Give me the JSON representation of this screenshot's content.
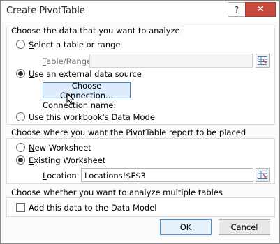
{
  "window": {
    "title": "Create PivotTable",
    "help_glyph": "?",
    "close_glyph": "✕"
  },
  "section_data": {
    "legend": "Choose the data that you want to analyze",
    "option_table_label": "Select a table or range",
    "table_range_label": "Table/Range:",
    "table_range_value": "",
    "option_external_label": "Use an external data source",
    "choose_connection_label": "Choose Connection...",
    "connection_name_label": "Connection name:",
    "option_datamodel_label": "Use this workbook's Data Model",
    "selected": "external"
  },
  "section_placement": {
    "legend": "Choose where you want the PivotTable report to be placed",
    "option_new_label": "New Worksheet",
    "option_existing_label": "Existing Worksheet",
    "location_label": "Location:",
    "location_value": "Locations!$F$3",
    "selected": "existing"
  },
  "section_multi": {
    "legend": "Choose whether you want to analyze multiple tables",
    "add_datamodel_label": "Add this data to the Data Model",
    "add_datamodel_checked": false
  },
  "footer": {
    "ok_label": "OK",
    "cancel_label": "Cancel"
  },
  "icons": {
    "range_selector": "range-selector-icon",
    "cursor": "mouse-pointer-icon"
  }
}
